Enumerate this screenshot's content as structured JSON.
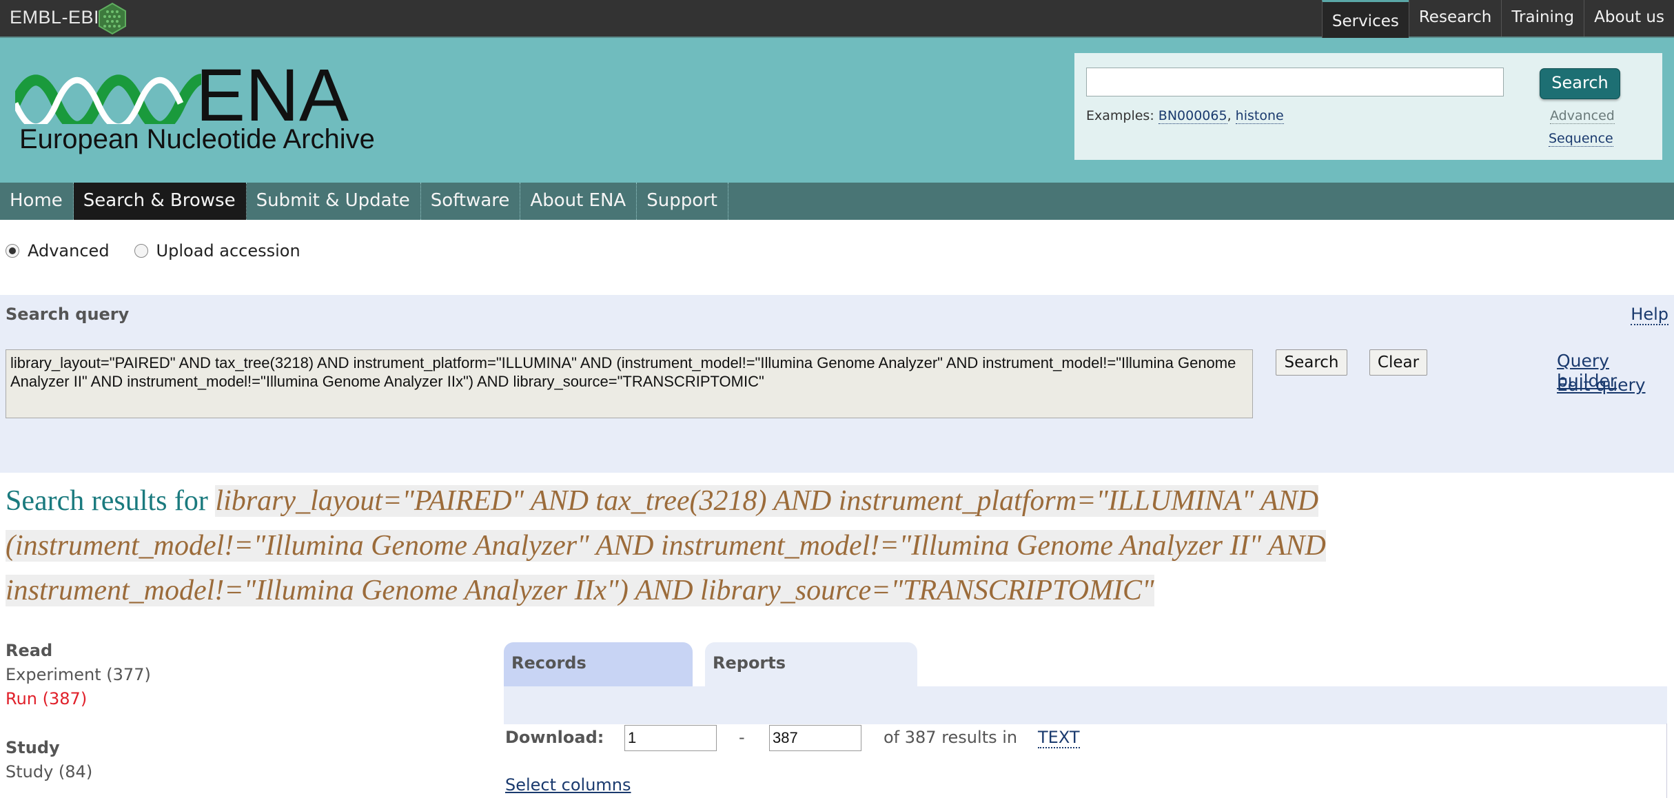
{
  "topbar": {
    "logo_text": "EMBL-EBI",
    "nav": [
      {
        "label": "Services"
      },
      {
        "label": "Research"
      },
      {
        "label": "Training"
      },
      {
        "label": "About us"
      }
    ]
  },
  "header": {
    "logo_main": "ENA",
    "logo_sub": "European Nucleotide Archive",
    "search": {
      "value": "",
      "button_label": "Search",
      "examples_label": "Examples: ",
      "example_1": "BN000065",
      "example_sep": ", ",
      "example_2": "histone",
      "advanced_label": "Advanced",
      "sequence_label": "Sequence"
    }
  },
  "mainnav": {
    "items": [
      {
        "label": "Home"
      },
      {
        "label": "Search & Browse"
      },
      {
        "label": "Submit & Update"
      },
      {
        "label": "Software"
      },
      {
        "label": "About ENA"
      },
      {
        "label": "Support"
      }
    ]
  },
  "mode": {
    "advanced_label": "Advanced",
    "upload_label": "Upload accession"
  },
  "query": {
    "title": "Search query",
    "help_label": "Help",
    "text": "library_layout=\"PAIRED\" AND tax_tree(3218) AND instrument_platform=\"ILLUMINA\" AND (instrument_model!=\"Illumina Genome Analyzer\" AND instrument_model!=\"Illumina Genome Analyzer II\" AND instrument_model!=\"Illumina Genome Analyzer IIx\") AND library_source=\"TRANSCRIPTOMIC\"",
    "search_label": "Search",
    "clear_label": "Clear",
    "builder_label": "Query builder",
    "edit_label": "Edit query"
  },
  "results": {
    "lead": "Search results for ",
    "query": "library_layout=\"PAIRED\" AND tax_tree(3218) AND instrument_platform=\"ILLUMINA\" AND (instrument_model!=\"Illumina Genome Analyzer\" AND instrument_model!=\"Illumina Genome Analyzer II\" AND instrument_model!=\"Illumina Genome Analyzer IIx\") AND library_source=\"TRANSCRIPTOMIC\""
  },
  "facets": {
    "read_heading": "Read",
    "experiment": "Experiment (377)",
    "run": "Run (387)",
    "study_heading": "Study",
    "study": "Study (84)"
  },
  "tabs": {
    "records": "Records",
    "reports": "Reports"
  },
  "download": {
    "label": "Download:",
    "from": "1",
    "dash": "-",
    "to": "387",
    "of_text": "of 387 results in",
    "format": "TEXT",
    "select_columns": "Select columns"
  },
  "colors": {
    "header_bg": "#70bcbe",
    "nav_bg": "#497575",
    "topbar_bg": "#333333",
    "panel_bg": "#e8edf8",
    "accent_green": "#1a9a3c"
  }
}
